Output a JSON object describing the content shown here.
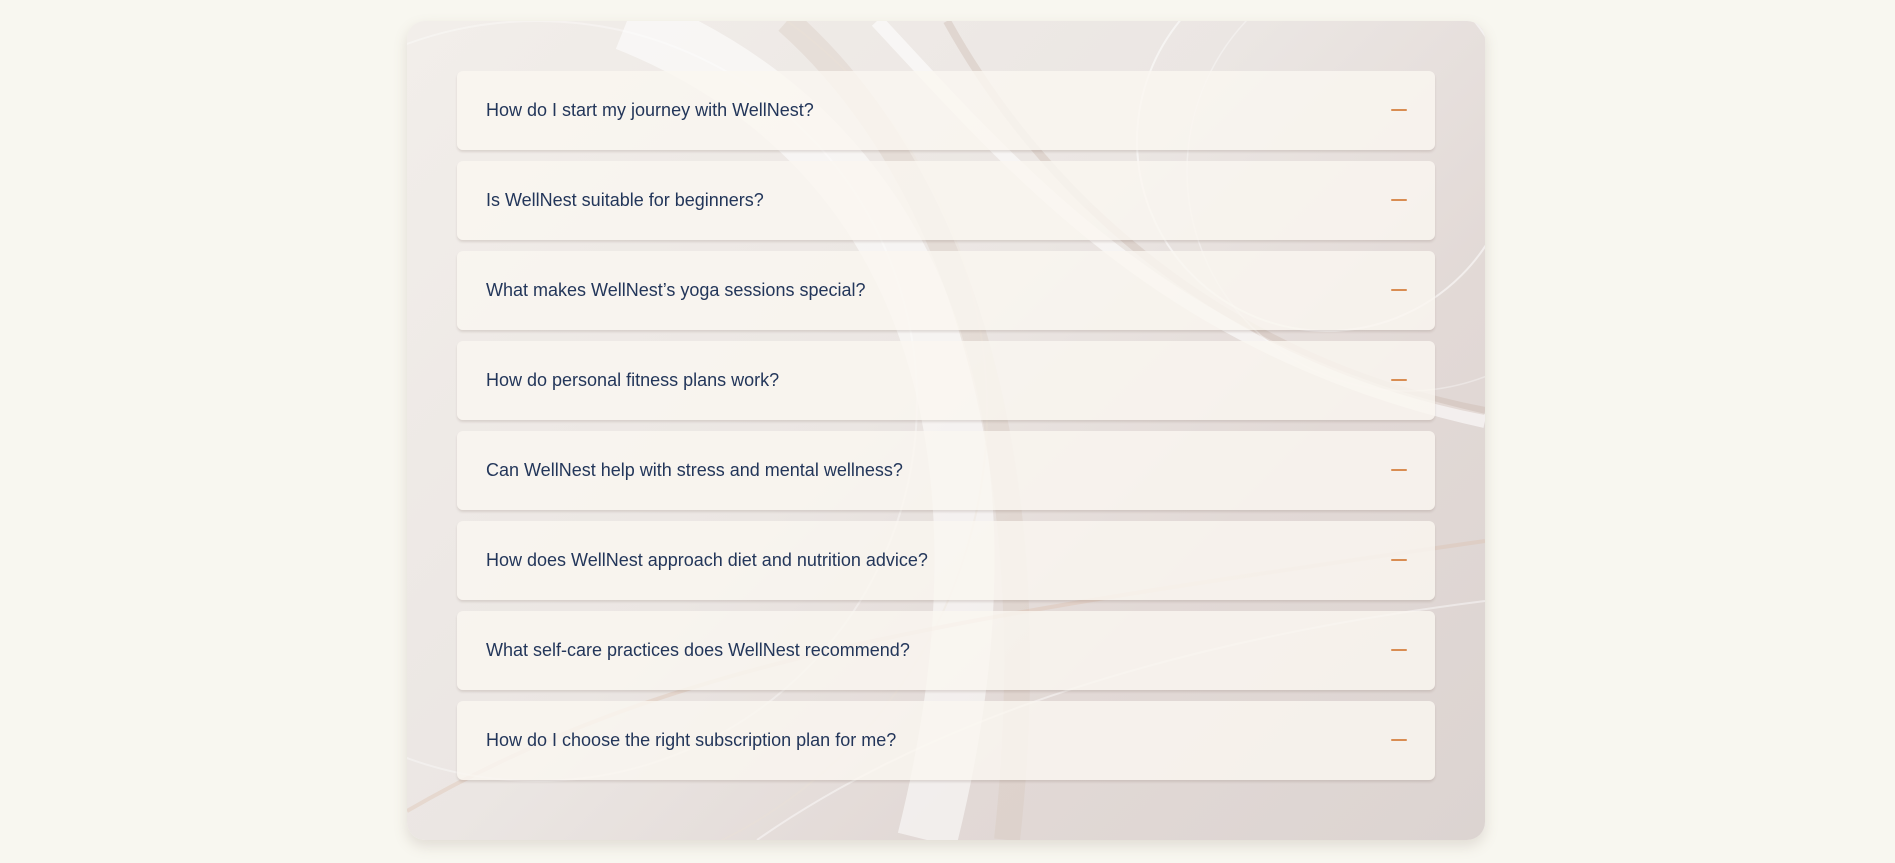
{
  "faq": {
    "accent_color": "#d98d52",
    "text_color": "#23365a",
    "items": [
      {
        "question": "How do I start my journey with WellNest?",
        "toggle_icon": "minus-icon"
      },
      {
        "question": "Is WellNest suitable for beginners?",
        "toggle_icon": "minus-icon"
      },
      {
        "question": "What makes WellNest’s yoga sessions special?",
        "toggle_icon": "minus-icon"
      },
      {
        "question": "How do personal fitness plans work?",
        "toggle_icon": "minus-icon"
      },
      {
        "question": "Can WellNest help with stress and mental wellness?",
        "toggle_icon": "minus-icon"
      },
      {
        "question": "How does WellNest approach diet and nutrition advice?",
        "toggle_icon": "minus-icon"
      },
      {
        "question": "What self-care practices does WellNest recommend?",
        "toggle_icon": "minus-icon"
      },
      {
        "question": "How do I choose the right subscription plan for me?",
        "toggle_icon": "minus-icon"
      }
    ]
  }
}
